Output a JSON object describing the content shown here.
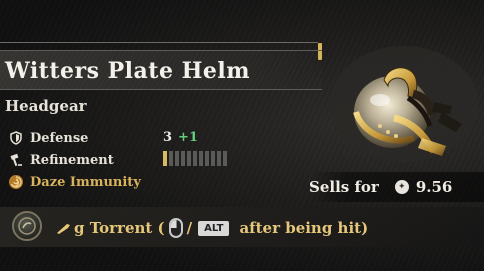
{
  "item": {
    "name": "Witters Plate Helm",
    "category": "Headgear"
  },
  "stats": {
    "defense_label": "Defense",
    "defense_value": "3",
    "defense_bonus": "+1",
    "refinement_label": "Refinement",
    "refinement_level": 1,
    "refinement_max": 11,
    "daze_label": "Daze Immunity"
  },
  "sell": {
    "label": "Sells for",
    "price": "9.56"
  },
  "hint": {
    "lead": "g Torrent (",
    "slash": "/",
    "alt_key": "ALT",
    "trail": "after being hit)"
  },
  "colors": {
    "accent_gold": "#d8b35c",
    "bonus_green": "#5fcf7a"
  },
  "icons": [
    "shield-icon",
    "hammer-icon",
    "daze-swirl-icon",
    "coin-icon",
    "torrent-icon",
    "mouse-icon",
    "helm-image"
  ]
}
